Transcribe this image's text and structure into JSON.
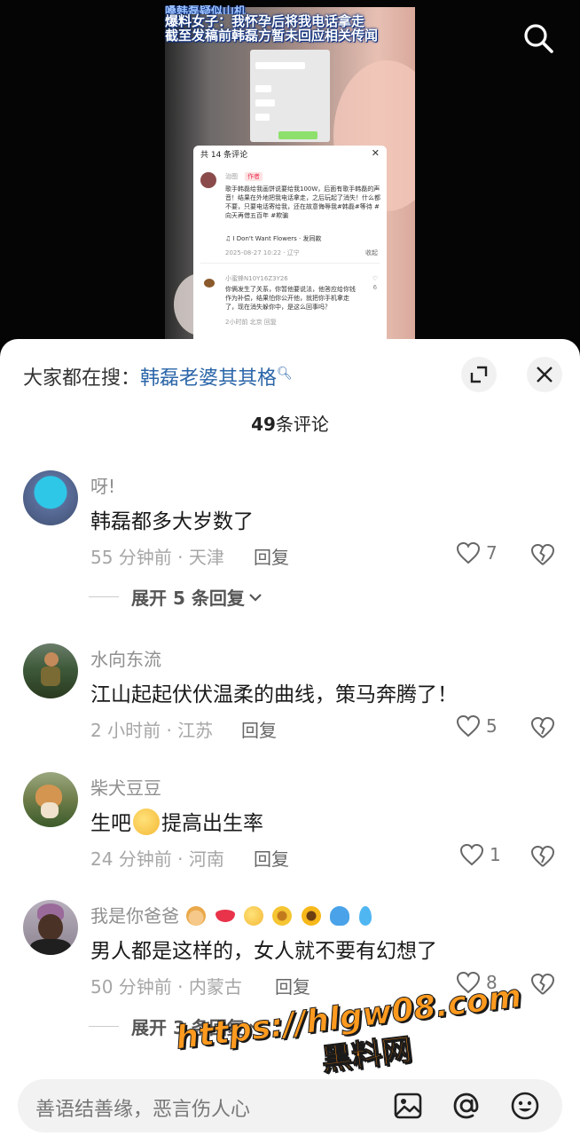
{
  "video": {
    "headline": [
      "嗓韩磊疑似山机",
      "爆料女子：我怀孕后将我电话拿走",
      "截至发稿前韩磊方暂未回应相关传闻"
    ],
    "screenshot_comments": {
      "header": "共 14 条评论",
      "author": "治图",
      "author_tag": "作者",
      "body": "歌手韩磊给我画饼说要给我100W，后面有歌手韩磊的声音！结果在外地把我电话拿走，之后玩起了消失！什么都不要，只要电话寄给我，还在故意侮辱我#韩磊#等待 #向天再借五百年 #欺骗",
      "music": "♫ I Don't Want Flowers · 发同款",
      "date": "2025-08-27 10:22 · 辽宁",
      "fold": "收起",
      "user2": "小蜜蜂N10Y16Z3Y26",
      "body2": "你俩发生了关系，你暂他要说法，他答应给你钱作为补偿，结果怕你公开他，就把你手机拿走了，现在消失躲你中，是这么回事吗？",
      "like2": "6",
      "meta2": "2小时前 北京 回复"
    }
  },
  "sheet": {
    "search_prefix": "大家都在搜：",
    "search_keyword": "韩磊老婆其其格",
    "count_number": "49",
    "count_label": "条评论"
  },
  "comments": [
    {
      "name": "呀!",
      "text": "韩磊都多大岁数了",
      "meta": "55 分钟前 · 天津",
      "reply": "回复",
      "likes": "7",
      "expand": "展开 5 条回复"
    },
    {
      "name": "水向东流",
      "text": "江山起起伏伏温柔的曲线，策马奔腾了！",
      "meta": "2 小时前 · 江苏",
      "reply": "回复",
      "likes": "5"
    },
    {
      "name": "柴犬豆豆",
      "text_before": "生吧",
      "text_after": "提高出生率",
      "meta": "24 分钟前 · 河南",
      "reply": "回复",
      "likes": "1"
    },
    {
      "name": "我是你爸爸",
      "text": "男人都是这样的，女人就不要有幻想了",
      "meta": "50 分钟前 · 内蒙古",
      "reply": "回复",
      "likes": "8",
      "expand": "展开 3 条回复"
    }
  ],
  "input": {
    "placeholder": "善语结善缘，恶言伤人心"
  },
  "watermark": {
    "url": "https://hlgw08.com",
    "name": "黑料网"
  }
}
